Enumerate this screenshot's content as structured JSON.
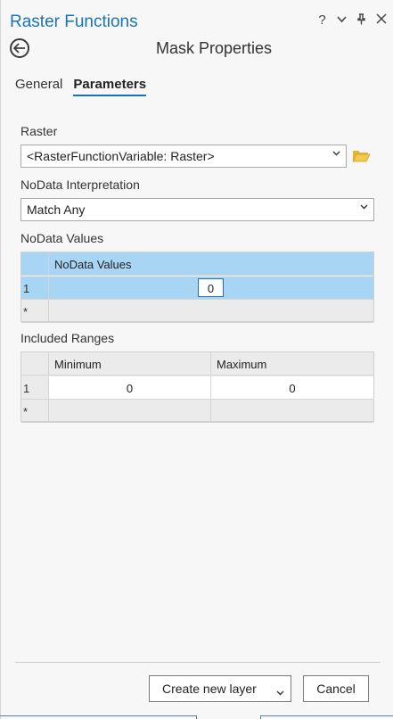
{
  "pane": {
    "title": "Raster Functions",
    "help_label": "?",
    "header_title": "Mask Properties"
  },
  "tabs": [
    {
      "label": "General",
      "active": false
    },
    {
      "label": "Parameters",
      "active": true
    }
  ],
  "raster": {
    "label": "Raster",
    "value": "<RasterFunctionVariable: Raster>"
  },
  "nodata_interpretation": {
    "label": "NoData Interpretation",
    "value": "Match Any"
  },
  "nodata_values": {
    "label": "NoData Values",
    "column": "NoData Values",
    "rows": [
      {
        "num": "1",
        "value": "0"
      },
      {
        "num": "*",
        "value": ""
      }
    ]
  },
  "included_ranges": {
    "label": "Included Ranges",
    "columns": [
      "Minimum",
      "Maximum"
    ],
    "rows": [
      {
        "num": "1",
        "min": "0",
        "max": "0"
      },
      {
        "num": "*",
        "min": "",
        "max": ""
      }
    ]
  },
  "footer": {
    "create_label": "Create new layer",
    "cancel_label": "Cancel"
  },
  "colors": {
    "accent": "#1a73b8",
    "selected_row": "#a9d5f5"
  },
  "icons": [
    "back-arrow-icon",
    "folder-icon",
    "chevron-down-icon",
    "pin-icon",
    "close-icon",
    "help-icon"
  ]
}
